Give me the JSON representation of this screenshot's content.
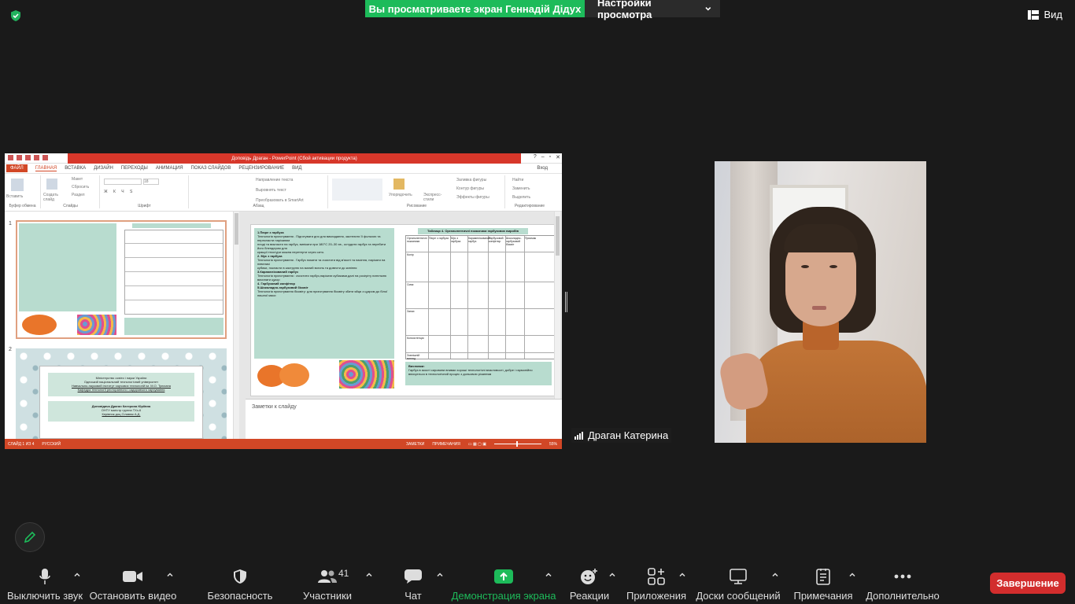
{
  "banner": {
    "sharing_text": "Вы просматриваете экран Геннадій Дідух",
    "view_options": "Настройки просмотра",
    "view_button": "Вид"
  },
  "powerpoint": {
    "title": "Доповідь Драган - PowerPoint (Сбой активации продукта)",
    "tabs": [
      "ФАЙЛ",
      "ГЛАВНАЯ",
      "ВСТАВКА",
      "ДИЗАЙН",
      "ПЕРЕХОДЫ",
      "АНИМАЦИЯ",
      "ПОКАЗ СЛАЙДОВ",
      "РЕЦЕНЗИРОВАНИЕ",
      "ВИД"
    ],
    "login": "Вход",
    "groups": {
      "clipboard": "Буфер обмена",
      "slides": "Слайды",
      "font": "Шрифт",
      "paragraph": "Абзац",
      "drawing": "Рисование",
      "editing": "Редактирование"
    },
    "buttons": {
      "paste": "Вставить",
      "create_slide": "Создать слайд",
      "layout": "Макет",
      "reset": "Сбросить",
      "section": "Раздел",
      "text_direction": "Направление текста",
      "align_text": "Выровнять текст",
      "convert_smartart": "Преобразовать в SmartArt",
      "arrange": "Упорядочить",
      "quick_styles": "Экспресс-стили",
      "shape_fill": "Заливка фигуры",
      "shape_outline": "Контур фигуры",
      "shape_effects": "Эффекты фигуры",
      "find": "Найти",
      "replace": "Заменить",
      "select": "Выделить",
      "font_size": "18"
    },
    "thumb_numbers": [
      "1",
      "2"
    ],
    "slide1": {
      "panel_lines": [
        "1.Пюре з гарбуза",
        "Технологія приготування . Підготувати дно для викладання, застелити її фольгою та перекласти нарізаним",
        "плоді та викласти на гарбуз, випікати при 180°С 20–30 хв., остудити гарбуз та перебити його блендером для",
        "кращої текстури можна перетерти через сито.",
        "2. Мус з гарбуза",
        "Технологія приготування . Гарбуз помити та очистити від м'якоті та насіння, нарізати на невеликі",
        "кубики, покласти в каструлю на малий вогонь та довести до кипіння",
        "3.Карамелізований гарбуз",
        "Технологія приготування : очистити гарбуз,нарізати кубиками,далі на розігріту пательню висипати цукор",
        "4. Гарбузовий конфітюр",
        "5.Шоколадно-гарбузовий бісквіт",
        "Технологія приготування бісквіту: для приготування бісквіту збити яйця з цукром до білої пишної маси"
      ],
      "table_title": "Таблиця 4. Органолептичні показники гарбузових виробів",
      "table_headers": [
        "Органолептичні показники",
        "Пюре з гарбуза",
        "Мус з гарбуза",
        "Карамелізований гарбуз",
        "Гарбузовий конфітюр",
        "Шоколадно-гарбузовий бісквіт",
        "Присмак"
      ],
      "table_rows": [
        "Колір",
        "Смак",
        "Запах",
        "Консистенція",
        "Зовнішній вигляд"
      ],
      "conclusion_title": "Висновки:",
      "conclusion_text": "Гарбуз в якості сировини вниває хороші технологічні властивості, добре і гармонійно вписується в технологічний процес з дольовою різанням",
      "notes_placeholder": "Заметки к слайду"
    },
    "slide2": {
      "line1": "Міністерство освіти і науки України",
      "line2": "Одеський національний технологічний університет",
      "line3": "Навчально-науковий інститут харчових технологій ім. М.О. Трюхана",
      "line4": "Кафедра технології ресторанного і оздоровчого харчування",
      "line5": "Доповідача Драган Катерина Юріївна",
      "line6": "ОНТУ магістр группа ТХз-6",
      "line7": "Керівник доц Сілавюк А.Д."
    },
    "status": {
      "slide_of": "СЛАЙД 1 ИЗ 4",
      "language": "РУССКИЙ",
      "notes": "ЗАМЕТКИ",
      "comments": "ПРИМЕЧАНИЯ",
      "zoom": "55%"
    }
  },
  "participant": {
    "name": "Драган Катерина"
  },
  "toolbar": {
    "mute": "Выключить звук",
    "video": "Остановить видео",
    "security": "Безопасность",
    "participants": "Участники",
    "participants_count": "41",
    "chat": "Чат",
    "share": "Демонстрация экрана",
    "reactions": "Реакции",
    "apps": "Приложения",
    "whiteboards": "Доски сообщений",
    "notes": "Примечания",
    "more": "Дополнительно",
    "end": "Завершение"
  },
  "colors": {
    "share_green": "#1dbb5a",
    "end_red": "#d22d2d",
    "ppt_red": "#d24726"
  }
}
